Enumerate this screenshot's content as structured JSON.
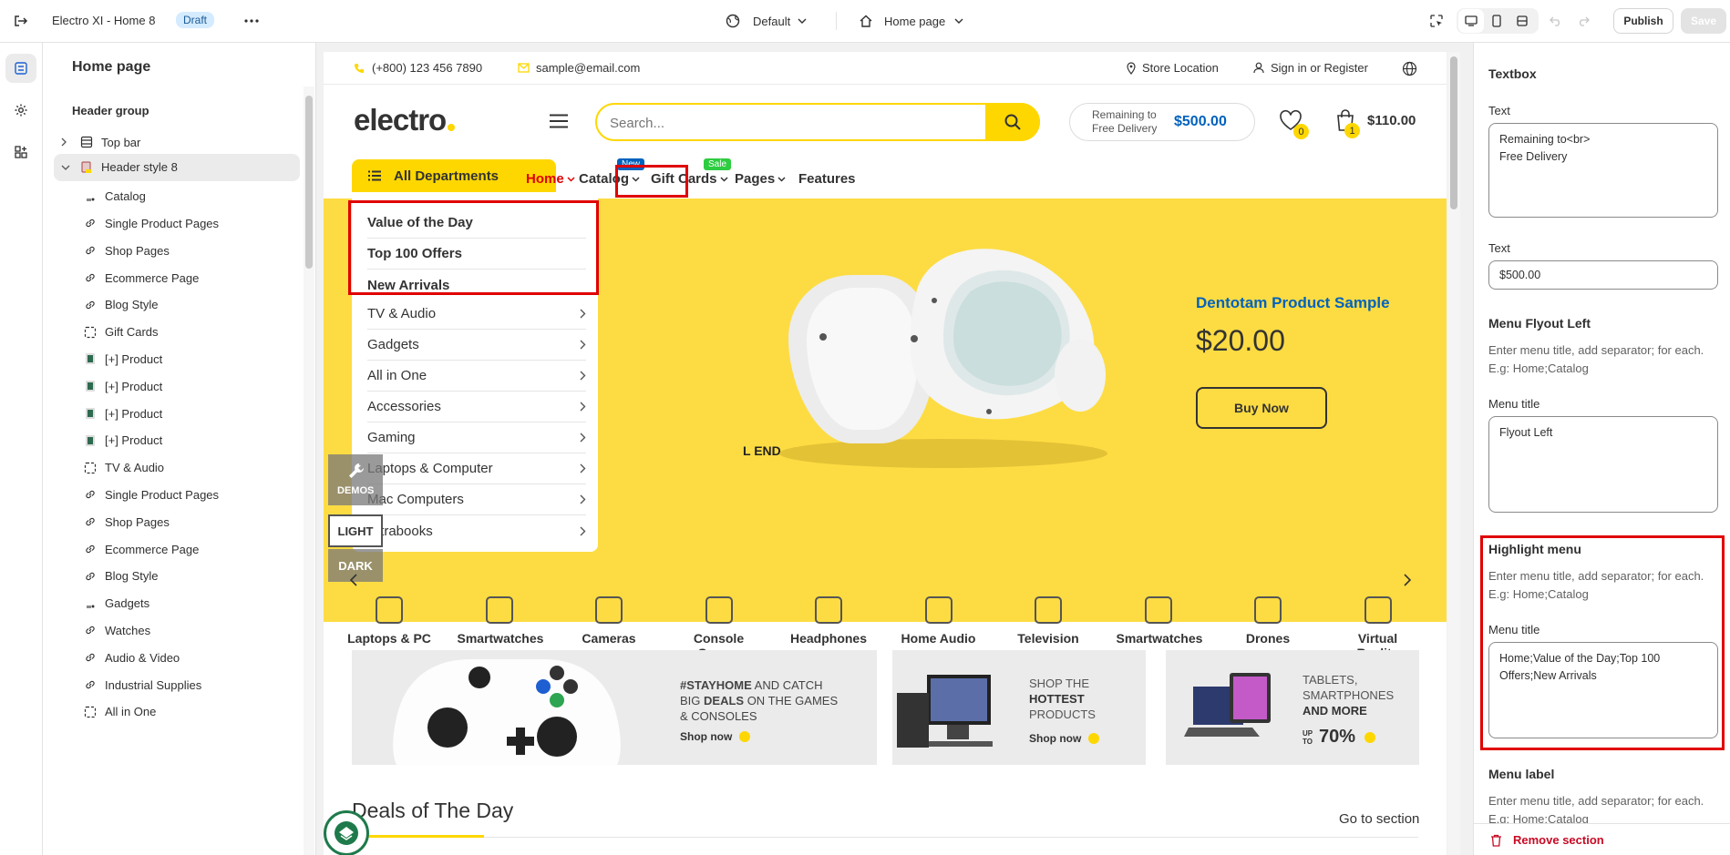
{
  "topbar": {
    "store_name": "Electro XI - Home 8",
    "status_badge": "Draft",
    "theme_select": "Default",
    "page_select": "Home page",
    "publish_label": "Publish",
    "save_label": "Save"
  },
  "left_panel": {
    "title": "Home page",
    "group_title": "Header group",
    "items": [
      {
        "label": "Top bar",
        "icon": "section-icon"
      },
      {
        "label": "Header style 8",
        "icon": "header-image-icon"
      },
      {
        "label": "Catalog",
        "icon": "image-icon"
      },
      {
        "label": "Single Product Pages",
        "icon": "link-icon"
      },
      {
        "label": "Shop Pages",
        "icon": "link-icon"
      },
      {
        "label": "Ecommerce Page",
        "icon": "link-icon"
      },
      {
        "label": "Blog Style",
        "icon": "link-icon"
      },
      {
        "label": "Gift Cards",
        "icon": "dashed-box-icon"
      },
      {
        "label": "[+] Product",
        "icon": "product-thumb-icon"
      },
      {
        "label": "[+] Product",
        "icon": "product-thumb-icon"
      },
      {
        "label": "[+] Product",
        "icon": "product-thumb-icon"
      },
      {
        "label": "[+] Product",
        "icon": "product-thumb-icon"
      },
      {
        "label": "TV & Audio",
        "icon": "dashed-box-icon"
      },
      {
        "label": "Single Product Pages",
        "icon": "link-icon"
      },
      {
        "label": "Shop Pages",
        "icon": "link-icon"
      },
      {
        "label": "Ecommerce Page",
        "icon": "link-icon"
      },
      {
        "label": "Blog Style",
        "icon": "link-icon"
      },
      {
        "label": "Gadgets",
        "icon": "image-icon"
      },
      {
        "label": "Watches",
        "icon": "link-icon"
      },
      {
        "label": "Audio & Video",
        "icon": "link-icon"
      },
      {
        "label": "Industrial Supplies",
        "icon": "link-icon"
      },
      {
        "label": "All in One",
        "icon": "dashed-box-icon"
      }
    ]
  },
  "preview": {
    "phone": "(+800) 123 456 7890",
    "email": "sample@email.com",
    "store_location": "Store Location",
    "sign_in": "Sign in or Register",
    "logo": "electro",
    "search_placeholder": "Search...",
    "free_delivery_line1": "Remaining to",
    "free_delivery_line2": "Free Delivery",
    "free_delivery_amount": "$500.00",
    "wishlist_count": "0",
    "cart_count": "1",
    "cart_total": "$110.00",
    "all_departments": "All Departments",
    "nav": [
      {
        "label": "Home"
      },
      {
        "label": "Catalog",
        "badge": "New"
      },
      {
        "label": "Gift Cards",
        "badge": "Sale"
      },
      {
        "label": "Pages"
      },
      {
        "label": "Features"
      }
    ],
    "highlight_items": [
      "Value of the Day",
      "Top 100 Offers",
      "New Arrivals"
    ],
    "dept_items": [
      "TV & Audio",
      "Gadgets",
      "All in One",
      "Accessories",
      "Gaming",
      "Laptops & Computer",
      "Mac Computers",
      "Ultrabooks"
    ],
    "hero_partial_text": "L END",
    "hero_product_title": "Dentotam Product Sample",
    "hero_price": "$20.00",
    "hero_button": "Buy Now",
    "demos_label": "DEMOS",
    "light_label": "LIGHT",
    "dark_label": "DARK",
    "categories": [
      "Laptops & PC",
      "Smartwatches",
      "Cameras",
      "Console Games",
      "Headphones",
      "Home Audio",
      "Television",
      "Smartwatches",
      "Drones",
      "Virtual Reality"
    ],
    "banner1": {
      "line1a": "#STAYHOME",
      "line1b": " AND CATCH",
      "line2a": "BIG ",
      "line2b": "DEALS",
      "line2c": " ON THE GAMES",
      "line3": "& CONSOLES",
      "cta": "Shop now"
    },
    "banner2": {
      "line1": "SHOP THE",
      "line2": "HOTTEST",
      "line3": "PRODUCTS",
      "cta": "Shop now"
    },
    "banner3": {
      "line1": "TABLETS,",
      "line2": "SMARTPHONES",
      "line3": "AND MORE",
      "upto": "UP TO",
      "pct": "70%"
    },
    "deals_title": "Deals of The Day",
    "goto_section": "Go to section"
  },
  "right_panel": {
    "section_title": "Textbox",
    "text1_label": "Text",
    "text1_value_l1": "Remaining to<br>",
    "text1_value_l2": "Free Delivery",
    "text2_label": "Text",
    "text2_value": "$500.00",
    "flyout_title": "Menu Flyout Left",
    "flyout_help": "Enter menu title, add separator; for each. E.g: Home;Catalog",
    "flyout_field_label": "Menu title",
    "flyout_value": "Flyout Left",
    "highlight_title": "Highlight menu",
    "highlight_help": "Enter menu title, add separator; for each. E.g: Home;Catalog",
    "highlight_field_label": "Menu title",
    "highlight_value": "Home;Value of the Day;Top 100 Offers;New Arrivals",
    "menu_label_title": "Menu label",
    "menu_label_help": "Enter menu title, add separator; for each. E.g: Home;Catalog",
    "remove_section": "Remove section"
  },
  "colors": {
    "accent_yellow": "#fed700",
    "highlight_red": "#e00000",
    "brand_blue": "#0062bd"
  }
}
